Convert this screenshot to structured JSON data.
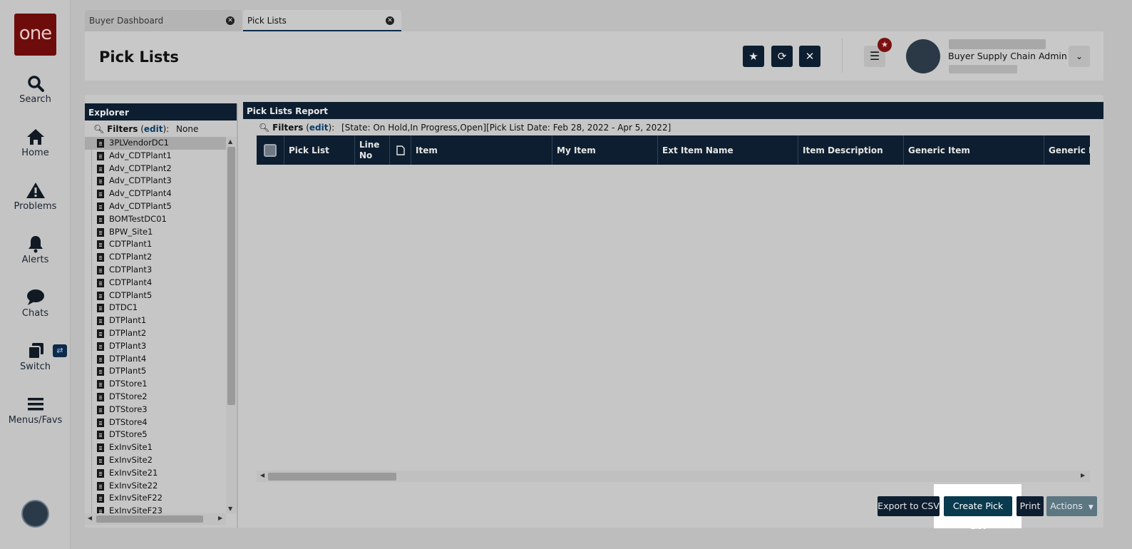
{
  "logo": {
    "text": "one"
  },
  "nav": [
    {
      "label": "Search",
      "icon": "search-icon"
    },
    {
      "label": "Home",
      "icon": "home-icon"
    },
    {
      "label": "Problems",
      "icon": "warning-icon"
    },
    {
      "label": "Alerts",
      "icon": "bell-icon"
    },
    {
      "label": "Chats",
      "icon": "chat-icon"
    },
    {
      "label": "Switch",
      "icon": "switch-icon"
    },
    {
      "label": "Menus/Favs",
      "icon": "hamburger-icon"
    }
  ],
  "tabs": [
    {
      "label": "Buyer Dashboard"
    },
    {
      "label": "Pick Lists"
    }
  ],
  "header": {
    "title": "Pick Lists",
    "user_role": "Buyer Supply Chain Admin"
  },
  "explorer": {
    "title": "Explorer",
    "filters_label": "Filters",
    "edit_label": "edit",
    "filters_value": "None",
    "items": [
      "3PLVendorDC1",
      "Adv_CDTPlant1",
      "Adv_CDTPlant2",
      "Adv_CDTPlant3",
      "Adv_CDTPlant4",
      "Adv_CDTPlant5",
      "BOMTestDC01",
      "BPW_Site1",
      "CDTPlant1",
      "CDTPlant2",
      "CDTPlant3",
      "CDTPlant4",
      "CDTPlant5",
      "DTDC1",
      "DTPlant1",
      "DTPlant2",
      "DTPlant3",
      "DTPlant4",
      "DTPlant5",
      "DTStore1",
      "DTStore2",
      "DTStore3",
      "DTStore4",
      "DTStore5",
      "ExInvSite1",
      "ExInvSite2",
      "ExInvSite21",
      "ExInvSite22",
      "ExInvSiteF22",
      "ExInvSiteF23"
    ]
  },
  "report": {
    "title": "Pick Lists Report",
    "filters_label": "Filters",
    "edit_label": "edit",
    "filters_value": "[State: On Hold,In Progress,Open][Pick List Date: Feb 28, 2022 - Apr 5, 2022]",
    "columns": [
      "Pick List",
      "Line No",
      "Item",
      "My Item",
      "Ext Item Name",
      "Item Description",
      "Generic Item",
      "Generic Ite"
    ]
  },
  "buttons": {
    "export": "Export to CSV",
    "create": "Create Pick List",
    "print": "Print",
    "actions": "Actions"
  }
}
